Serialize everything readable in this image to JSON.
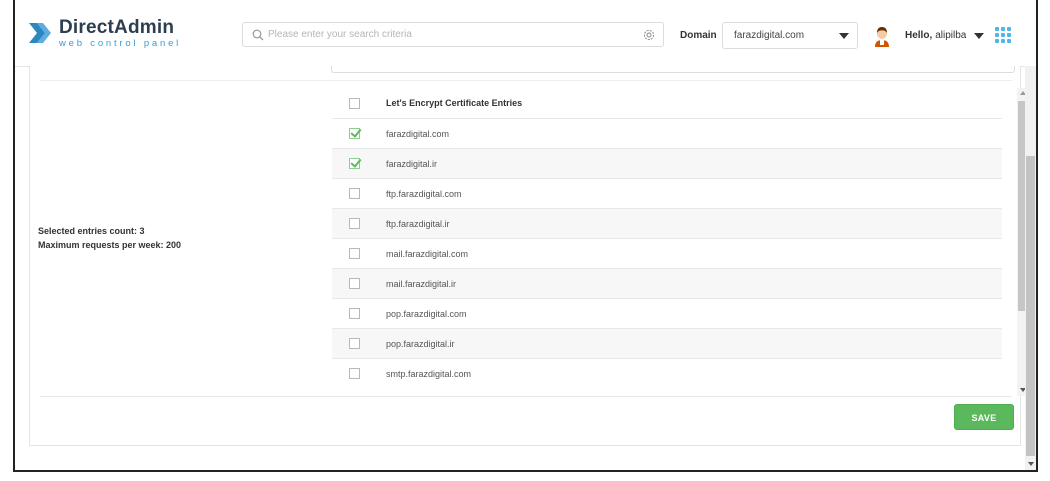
{
  "header": {
    "logo_title": "DirectAdmin",
    "logo_subtitle": "web control panel",
    "search_placeholder": "Please enter your search criteria",
    "domain_label": "Domain",
    "domain_value": "farazdigital.com",
    "hello_prefix": "Hello,",
    "username": "alipilba"
  },
  "info": {
    "selected_count_text": "Selected entries count: 3",
    "max_requests_text": "Maximum requests per week: 200"
  },
  "table": {
    "header_label": "Let's Encrypt Certificate Entries",
    "header_checked": false,
    "rows": [
      {
        "label": "farazdigital.com",
        "checked": true
      },
      {
        "label": "farazdigital.ir",
        "checked": true
      },
      {
        "label": "ftp.farazdigital.com",
        "checked": false
      },
      {
        "label": "ftp.farazdigital.ir",
        "checked": false
      },
      {
        "label": "mail.farazdigital.com",
        "checked": false
      },
      {
        "label": "mail.farazdigital.ir",
        "checked": false
      },
      {
        "label": "pop.farazdigital.com",
        "checked": false
      },
      {
        "label": "pop.farazdigital.ir",
        "checked": false
      },
      {
        "label": "smtp.farazdigital.com",
        "checked": false
      }
    ]
  },
  "actions": {
    "save_label": "SAVE"
  },
  "colors": {
    "accent_green": "#5cb85c",
    "logo_blue": "#3a9ad9",
    "apps_icon": "#4db8e8"
  }
}
